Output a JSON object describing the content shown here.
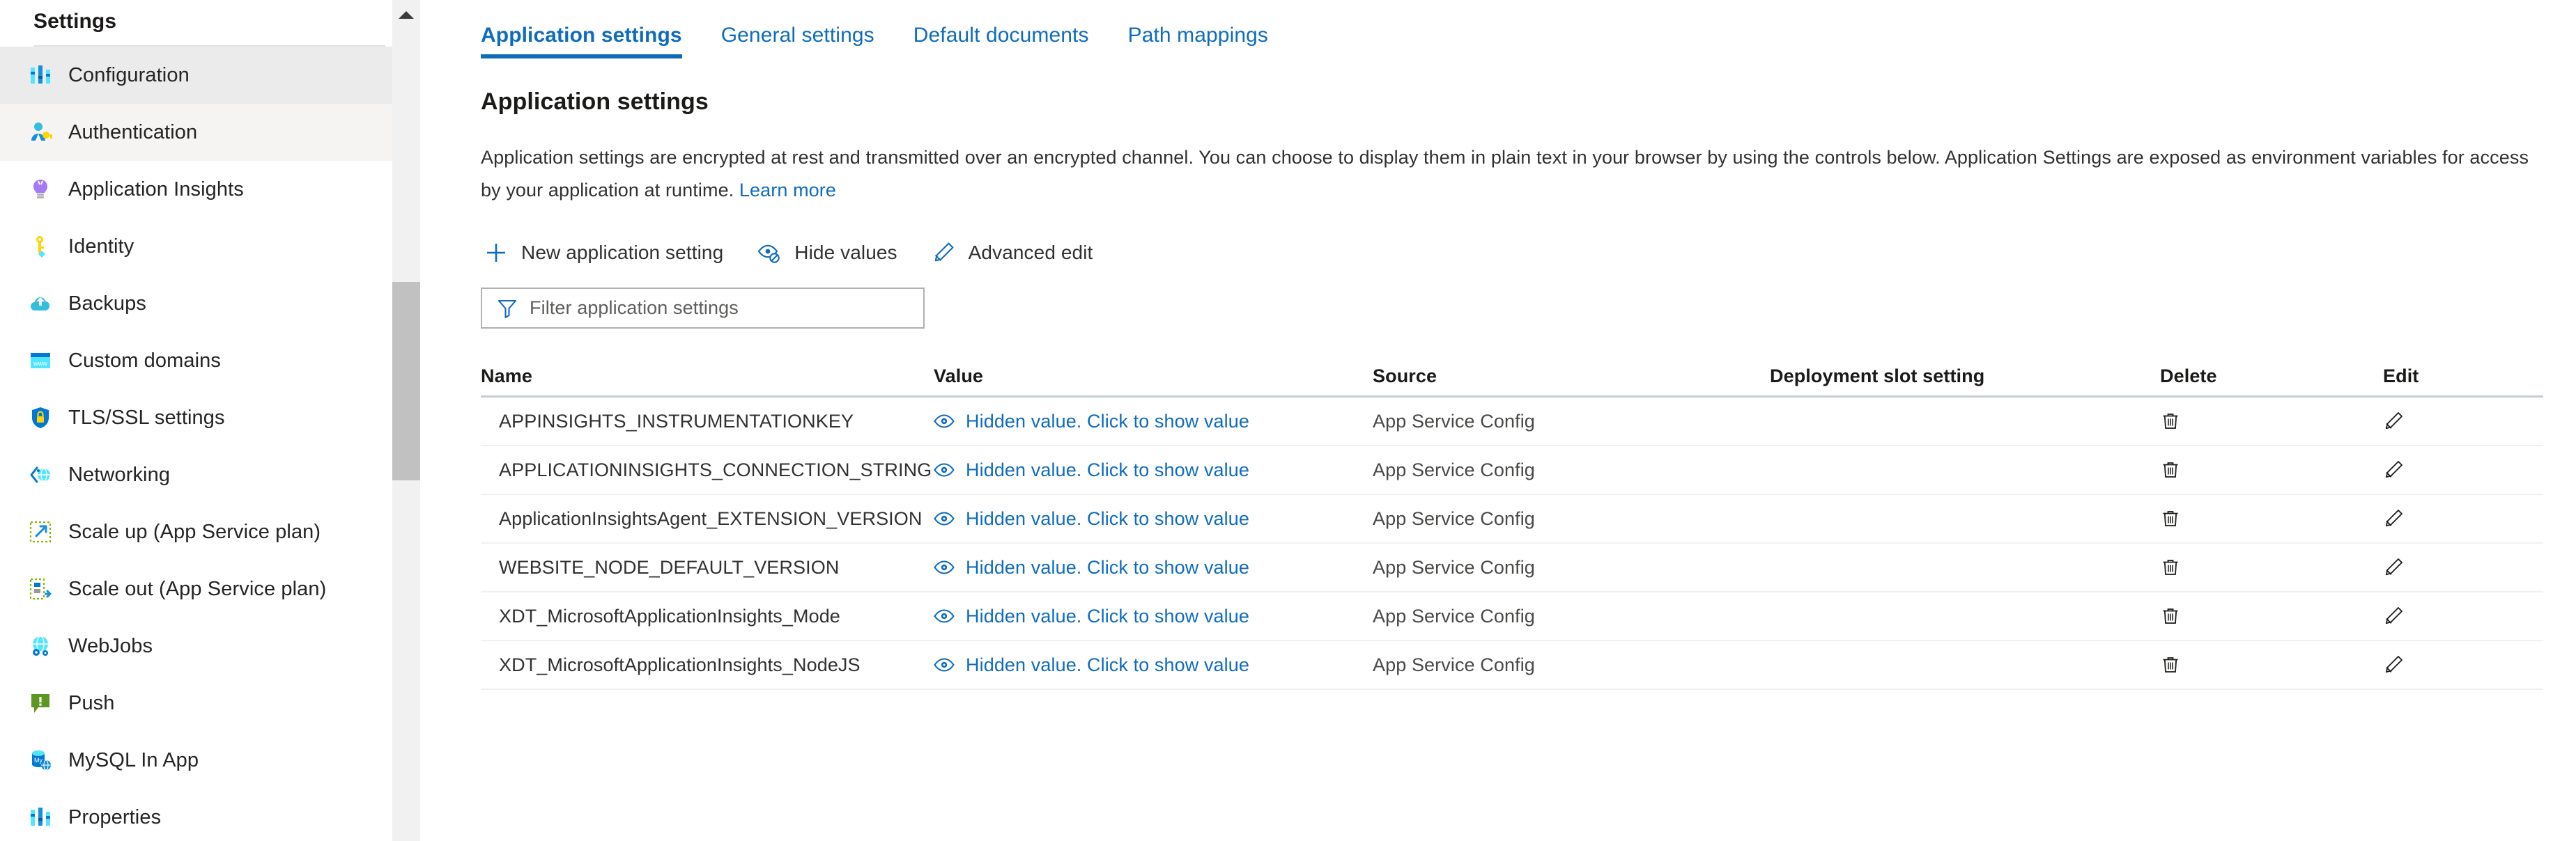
{
  "sidebar": {
    "title": "Settings",
    "items": [
      {
        "label": "Configuration",
        "icon": "sliders-icon",
        "selected": true
      },
      {
        "label": "Authentication",
        "icon": "user-key-icon",
        "selected": false
      },
      {
        "label": "Application Insights",
        "icon": "lightbulb-icon",
        "selected": false
      },
      {
        "label": "Identity",
        "icon": "key-icon",
        "selected": false
      },
      {
        "label": "Backups",
        "icon": "cloud-backup-icon",
        "selected": false
      },
      {
        "label": "Custom domains",
        "icon": "www-browser-icon",
        "selected": false
      },
      {
        "label": "TLS/SSL settings",
        "icon": "shield-lock-icon",
        "selected": false
      },
      {
        "label": "Networking",
        "icon": "network-globe-icon",
        "selected": false
      },
      {
        "label": "Scale up (App Service plan)",
        "icon": "scale-up-icon",
        "selected": false
      },
      {
        "label": "Scale out (App Service plan)",
        "icon": "scale-out-icon",
        "selected": false
      },
      {
        "label": "WebJobs",
        "icon": "webjobs-gear-icon",
        "selected": false
      },
      {
        "label": "Push",
        "icon": "push-alert-icon",
        "selected": false
      },
      {
        "label": "MySQL In App",
        "icon": "mysql-database-icon",
        "selected": false
      },
      {
        "label": "Properties",
        "icon": "sliders-icon",
        "selected": false
      }
    ],
    "scrollbar": {
      "up_arrow": "scroll-up-arrow-icon"
    }
  },
  "tabs": [
    {
      "label": "Application settings",
      "active": true
    },
    {
      "label": "General settings",
      "active": false
    },
    {
      "label": "Default documents",
      "active": false
    },
    {
      "label": "Path mappings",
      "active": false
    }
  ],
  "section": {
    "title": "Application settings",
    "description": "Application settings are encrypted at rest and transmitted over an encrypted channel. You can choose to display them in plain text in your browser by using the controls below. Application Settings are exposed as environment variables for access by your application at runtime.",
    "learn_more": "Learn more"
  },
  "commands": [
    {
      "label": "New application setting",
      "icon": "plus-icon"
    },
    {
      "label": "Hide values",
      "icon": "eye-hidden-icon"
    },
    {
      "label": "Advanced edit",
      "icon": "pencil-icon"
    }
  ],
  "filter": {
    "placeholder": "Filter application settings",
    "value": "",
    "icon": "funnel-icon"
  },
  "table": {
    "columns": [
      "Name",
      "Value",
      "Source",
      "Deployment slot setting",
      "Delete",
      "Edit"
    ],
    "value_link_text": "Hidden value. Click to show value",
    "value_icon": "eye-icon",
    "delete_icon": "trash-icon",
    "edit_icon": "pencil-icon",
    "rows": [
      {
        "name": "APPINSIGHTS_INSTRUMENTATIONKEY",
        "value": "Hidden value. Click to show value",
        "source": "App Service Config",
        "slot": ""
      },
      {
        "name": "APPLICATIONINSIGHTS_CONNECTION_STRING",
        "value": "Hidden value. Click to show value",
        "source": "App Service Config",
        "slot": ""
      },
      {
        "name": "ApplicationInsightsAgent_EXTENSION_VERSION",
        "value": "Hidden value. Click to show value",
        "source": "App Service Config",
        "slot": ""
      },
      {
        "name": "WEBSITE_NODE_DEFAULT_VERSION",
        "value": "Hidden value. Click to show value",
        "source": "App Service Config",
        "slot": ""
      },
      {
        "name": "XDT_MicrosoftApplicationInsights_Mode",
        "value": "Hidden value. Click to show value",
        "source": "App Service Config",
        "slot": ""
      },
      {
        "name": "XDT_MicrosoftApplicationInsights_NodeJS",
        "value": "Hidden value. Click to show value",
        "source": "App Service Config",
        "slot": ""
      }
    ]
  },
  "colors": {
    "accent": "#0f6cbd",
    "selected_row": "#ebebeb",
    "alt_row": "#f5f4f3",
    "text": "#323130"
  }
}
